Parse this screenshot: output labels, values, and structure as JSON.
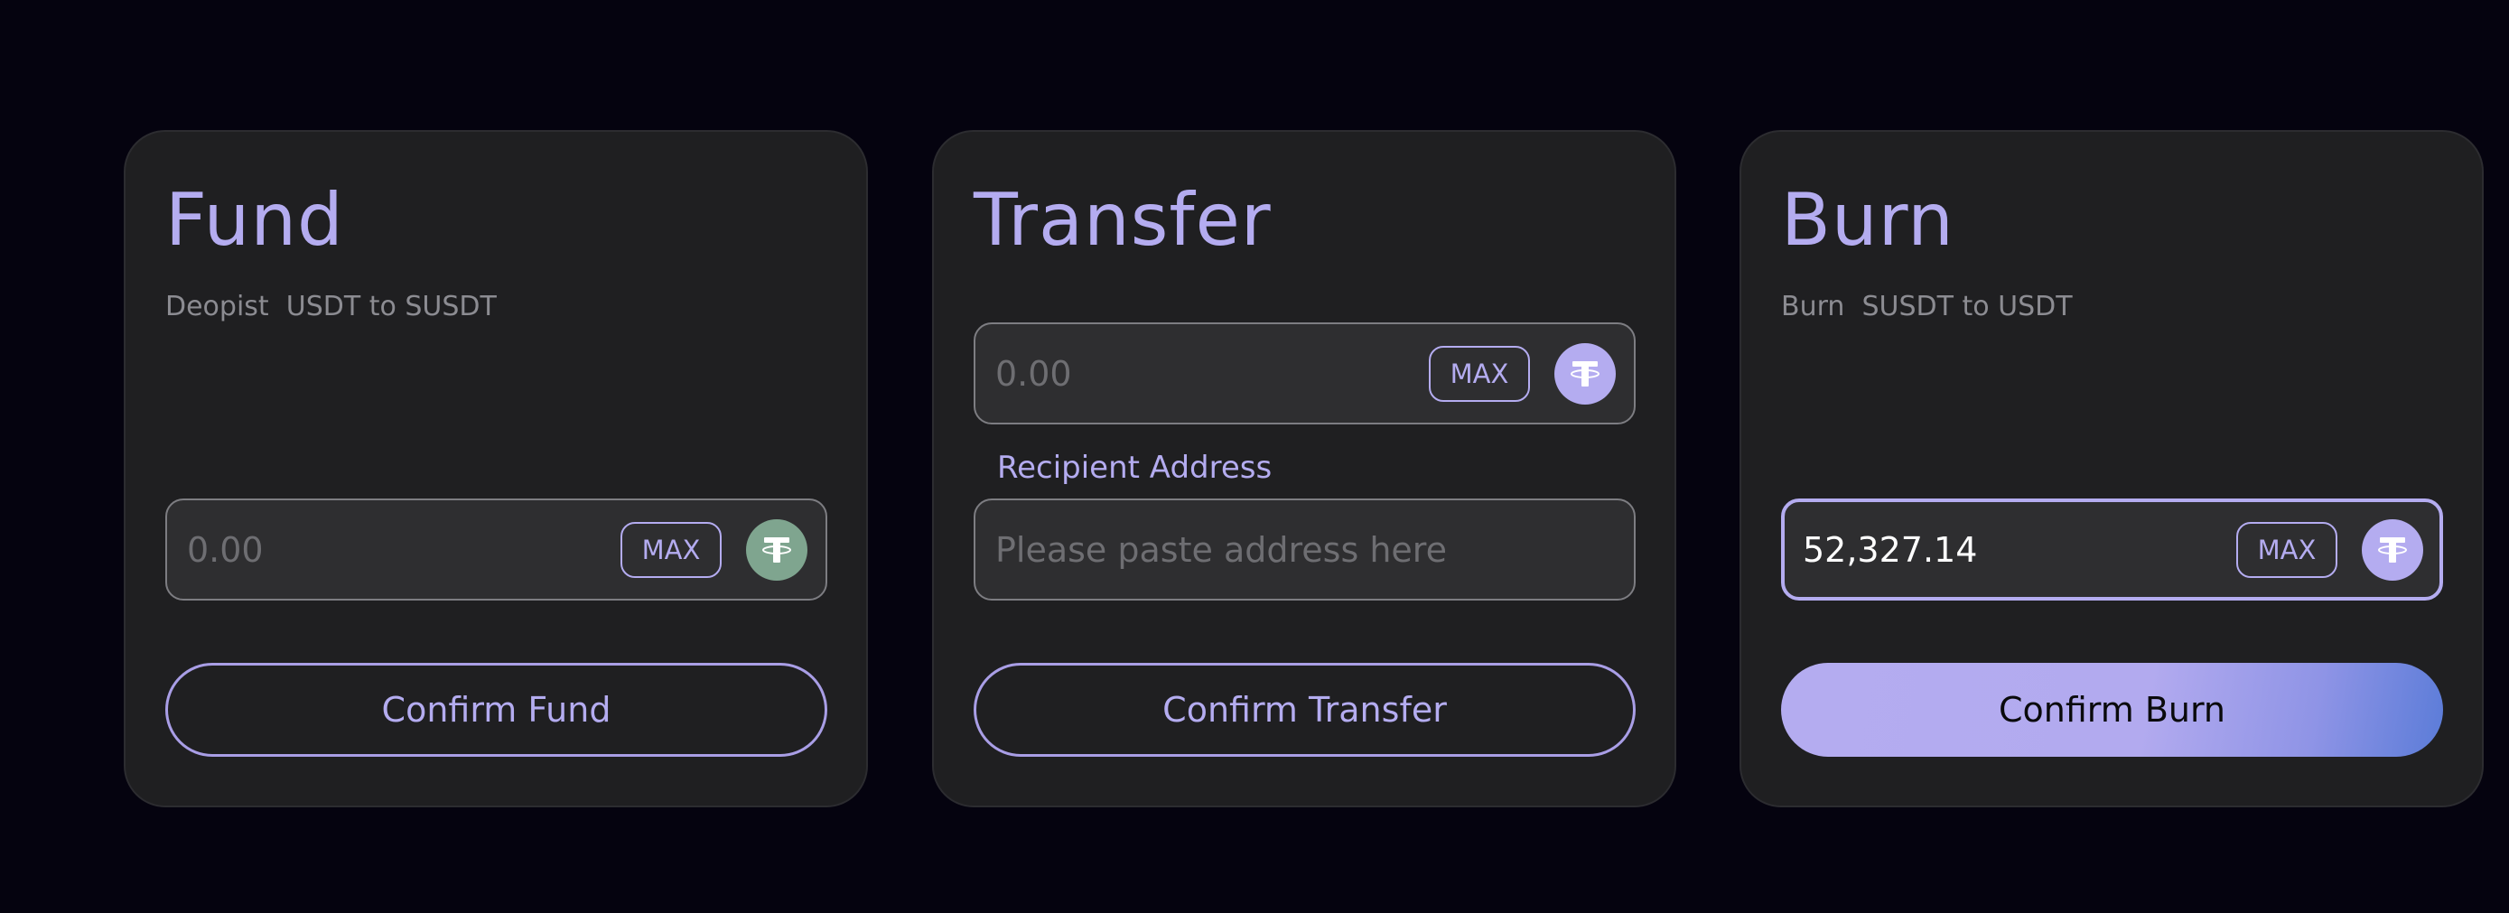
{
  "colors": {
    "background": "#05030f",
    "card": "#1f1f21",
    "accent": "#b4acf0",
    "fund_token": "#7fa58f",
    "gradient_end": "#5b7cd8"
  },
  "fund": {
    "title": "Fund",
    "subtitle": "Deopist  USDT to SUSDT",
    "amount_placeholder": "0.00",
    "max_label": "MAX",
    "token_icon": "tether-icon",
    "confirm_label": "Confirm Fund"
  },
  "transfer": {
    "title": "Transfer",
    "amount_placeholder": "0.00",
    "max_label": "MAX",
    "token_icon": "tether-icon",
    "recipient_label": "Recipient Address",
    "address_placeholder": "Please paste address here",
    "confirm_label": "Confirm Transfer"
  },
  "burn": {
    "title": "Burn",
    "subtitle": "Burn  SUSDT to USDT",
    "amount_value": "52,327.14",
    "max_label": "MAX",
    "token_icon": "tether-icon",
    "confirm_label": "Confirm Burn"
  }
}
